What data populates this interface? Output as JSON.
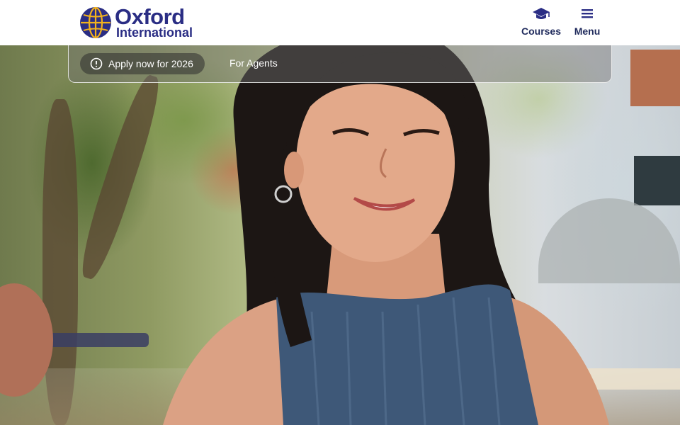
{
  "brand": {
    "name_line1": "Oxford",
    "name_line2": "International",
    "primary_color": "#2a2d84",
    "accent_color": "#f2b21c"
  },
  "header": {
    "courses": {
      "label": "Courses",
      "icon": "graduation-cap-icon"
    },
    "menu": {
      "label": "Menu",
      "icon": "hamburger-menu-icon"
    }
  },
  "subbar": {
    "apply": {
      "label": "Apply now for 2026",
      "icon": "alert-circle-icon"
    },
    "agents": {
      "label": "For Agents"
    }
  },
  "hero": {
    "image": "smiling-student-photo"
  }
}
